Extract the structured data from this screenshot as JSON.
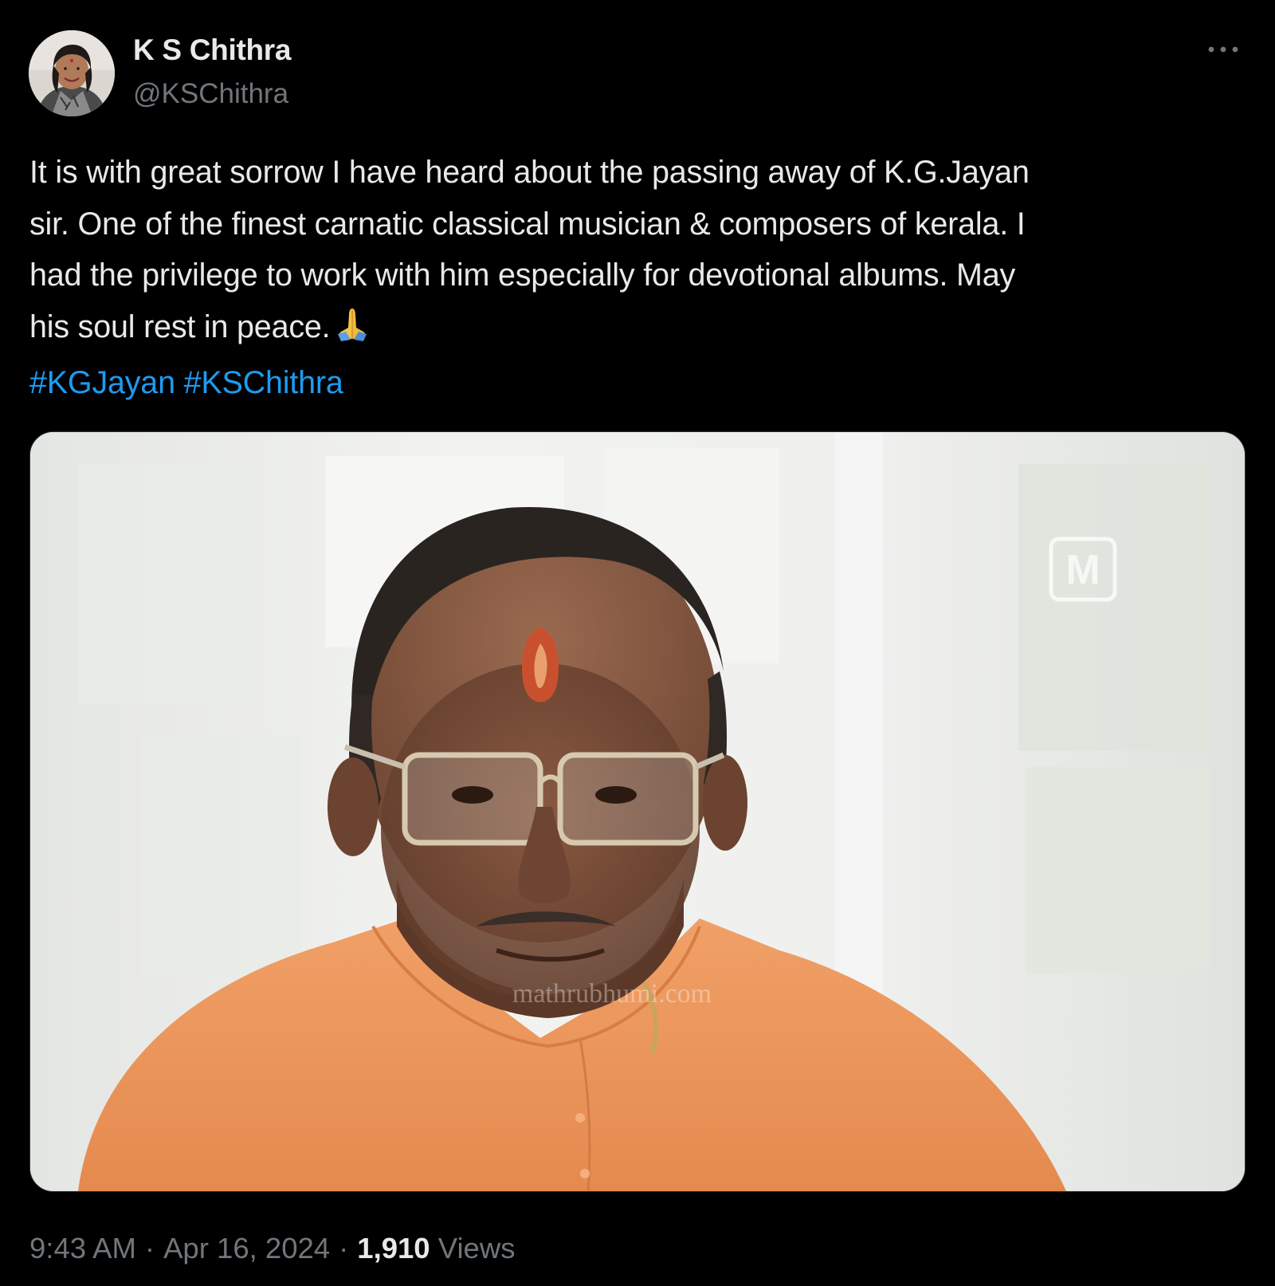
{
  "author": {
    "display_name": "K S Chithra",
    "handle": "@KSChithra"
  },
  "tweet": {
    "lines": [
      "It is with great sorrow I have heard about the passing away of K.G.Jayan",
      "sir. One of the finest carnatic classical musician & composers of kerala. I",
      "had the privilege to work with him especially for devotional albums. May",
      "his soul rest in peace."
    ],
    "emoji": "folded-hands-icon",
    "hashtags": [
      "#KGJayan",
      "#KSChithra"
    ]
  },
  "media": {
    "watermark_logo": "M",
    "watermark_text": "mathrubhumi.com"
  },
  "meta": {
    "time": "9:43 AM",
    "separator": "·",
    "date": "Apr 16, 2024",
    "views_count": "1,910",
    "views_label": "Views"
  },
  "colors": {
    "background": "#000000",
    "text_primary": "#e7e9ea",
    "text_secondary": "#71767b",
    "link": "#1d9bf0"
  }
}
